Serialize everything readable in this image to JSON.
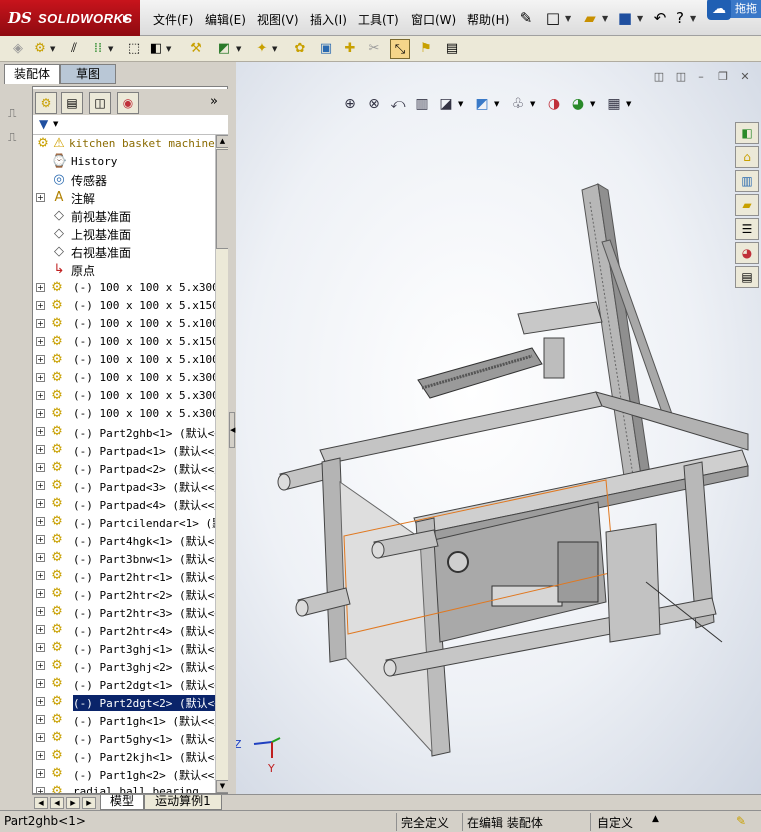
{
  "app": {
    "brand_ds": "DS",
    "brand_name": "SOLIDWORKS"
  },
  "menu": [
    "文件(F)",
    "编辑(E)",
    "视图(V)",
    "插入(I)",
    "工具(T)",
    "窗口(W)",
    "帮助(H)"
  ],
  "corner_tag": "拖拖",
  "tabs": {
    "assembly": "装配体",
    "sketch": "草图"
  },
  "tree": {
    "root": "kitchen basket machine m",
    "items": [
      {
        "label": "History",
        "icon": "history-icon",
        "expandable": false,
        "cjk": false
      },
      {
        "label": "传感器",
        "icon": "sensor-icon",
        "expandable": false,
        "cjk": true
      },
      {
        "label": "注解",
        "icon": "annotation-icon",
        "expandable": true,
        "cjk": true
      },
      {
        "label": "前视基准面",
        "icon": "plane-icon",
        "expandable": false,
        "cjk": true
      },
      {
        "label": "上视基准面",
        "icon": "plane-icon",
        "expandable": false,
        "cjk": true
      },
      {
        "label": "右视基准面",
        "icon": "plane-icon",
        "expandable": false,
        "cjk": true
      },
      {
        "label": "原点",
        "icon": "origin-icon",
        "expandable": false,
        "cjk": true
      },
      {
        "label": "(-) 100 x 100 x 5.x300 <",
        "icon": "component-icon",
        "expandable": true,
        "cjk": false
      },
      {
        "label": "(-) 100 x 100 x 5.x1500",
        "icon": "component-icon",
        "expandable": true,
        "cjk": false
      },
      {
        "label": "(-) 100 x 100 x 5.x1000",
        "icon": "component-icon",
        "expandable": true,
        "cjk": false
      },
      {
        "label": "(-) 100 x 100 x 5.x1500",
        "icon": "component-icon",
        "expandable": true,
        "cjk": false
      },
      {
        "label": "(-) 100 x 100 x 5.x1000",
        "icon": "component-icon",
        "expandable": true,
        "cjk": false
      },
      {
        "label": "(-) 100 x 100 x 5.x300 <",
        "icon": "component-icon",
        "expandable": true,
        "cjk": false
      },
      {
        "label": "(-) 100 x 100 x 5.x300 <",
        "icon": "component-icon",
        "expandable": true,
        "cjk": false
      },
      {
        "label": "(-) 100 x 100 x 5.x300 <",
        "icon": "component-icon",
        "expandable": true,
        "cjk": false
      },
      {
        "label": "(-) Part2ghb<1> (默认<<默",
        "icon": "component-icon",
        "expandable": true,
        "cjk": false
      },
      {
        "label": "(-) Partpad<1> (默认<<默",
        "icon": "component-icon",
        "expandable": true,
        "cjk": false
      },
      {
        "label": "(-) Partpad<2> (默认<<默",
        "icon": "component-icon",
        "expandable": true,
        "cjk": false
      },
      {
        "label": "(-) Partpad<3> (默认<<默",
        "icon": "component-icon",
        "expandable": true,
        "cjk": false
      },
      {
        "label": "(-) Partpad<4> (默认<<默",
        "icon": "component-icon",
        "expandable": true,
        "cjk": false
      },
      {
        "label": "(-) Partcilendar<1> (默认",
        "icon": "component-icon",
        "expandable": true,
        "cjk": false
      },
      {
        "label": "(-) Part4hgk<1> (默认<<默",
        "icon": "component-icon",
        "expandable": true,
        "cjk": false
      },
      {
        "label": "(-) Part3bnw<1> (默认<<默",
        "icon": "component-icon",
        "expandable": true,
        "cjk": false
      },
      {
        "label": "(-) Part2htr<1> (默认<<默",
        "icon": "component-icon",
        "expandable": true,
        "cjk": false
      },
      {
        "label": "(-) Part2htr<2> (默认<<默",
        "icon": "component-icon",
        "expandable": true,
        "cjk": false
      },
      {
        "label": "(-) Part2htr<3> (默认<<默",
        "icon": "component-icon",
        "expandable": true,
        "cjk": false
      },
      {
        "label": "(-) Part2htr<4> (默认<<默",
        "icon": "component-icon",
        "expandable": true,
        "cjk": false
      },
      {
        "label": "(-) Part3ghj<1> (默认<<默",
        "icon": "component-icon",
        "expandable": true,
        "cjk": false
      },
      {
        "label": "(-) Part3ghj<2> (默认<<默",
        "icon": "component-icon",
        "expandable": true,
        "cjk": false
      },
      {
        "label": "(-) Part2dgt<1> (默认<<默",
        "icon": "component-icon",
        "expandable": true,
        "cjk": false
      },
      {
        "label": "(-) Part2dgt<2> (默认<<",
        "icon": "component-icon",
        "expandable": true,
        "cjk": false,
        "selected": true
      },
      {
        "label": "(-) Part1gh<1> (默认<<默",
        "icon": "component-icon",
        "expandable": true,
        "cjk": false
      },
      {
        "label": "(-) Part5ghy<1> (默认<<默",
        "icon": "component-icon",
        "expandable": true,
        "cjk": false
      },
      {
        "label": "(-) Part2kjh<1> (默认<<默",
        "icon": "component-icon",
        "expandable": true,
        "cjk": false
      },
      {
        "label": "(-) Part1gh<2> (默认<<默",
        "icon": "component-icon",
        "expandable": true,
        "cjk": false
      },
      {
        "label": "radial ball bearing",
        "icon": "component-icon",
        "expandable": true,
        "cjk": false
      }
    ]
  },
  "bottom_tabs": {
    "model": "模型",
    "motion": "运动算例1"
  },
  "triad": {
    "z": "Z",
    "y": "Y"
  },
  "status": {
    "selection": "Part2ghb<1>",
    "constraint": "完全定义",
    "editing": "在编辑 装配体",
    "custom": "自定义"
  },
  "colors": {
    "brand": "#c8141c",
    "selection": "#0a246a",
    "frame": "#8a8a8a",
    "highlight": "#e07820"
  }
}
